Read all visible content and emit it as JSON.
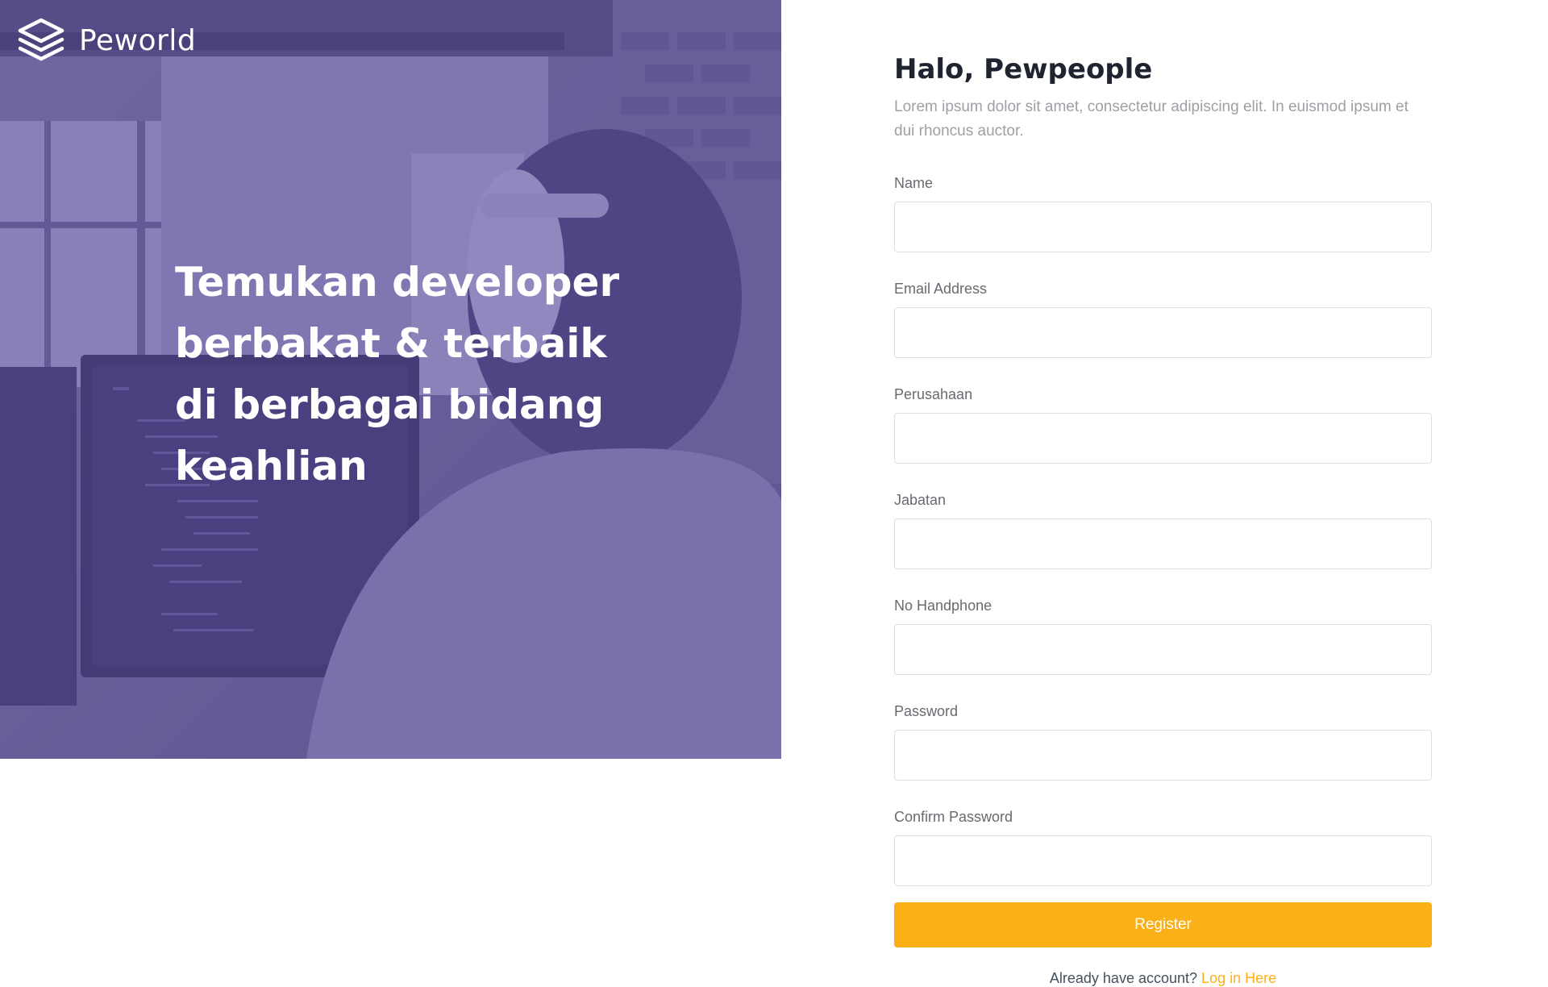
{
  "brand": {
    "name": "Peworld",
    "icon": "stacked-layers-icon"
  },
  "hero": {
    "headline": "Temukan developer berbakat & terbaik di berbagai bidang keahlian"
  },
  "form": {
    "title": "Halo, Pewpeople",
    "description": "Lorem ipsum dolor sit amet, consectetur adipiscing elit. In euismod ipsum et dui rhoncus auctor.",
    "fields": [
      {
        "label": "Name",
        "value": ""
      },
      {
        "label": "Email Address",
        "value": ""
      },
      {
        "label": "Perusahaan",
        "value": ""
      },
      {
        "label": "Jabatan",
        "value": ""
      },
      {
        "label": "No Handphone",
        "value": ""
      },
      {
        "label": "Password",
        "value": ""
      },
      {
        "label": "Confirm Password",
        "value": ""
      }
    ],
    "submit_label": "Register",
    "footer_text": "Already have account?",
    "login_link_label": "Log in Here"
  },
  "colors": {
    "hero_tint": "#5e50a1",
    "accent": "#fbb017",
    "title": "#1f2430",
    "muted": "#9ea0a5"
  }
}
